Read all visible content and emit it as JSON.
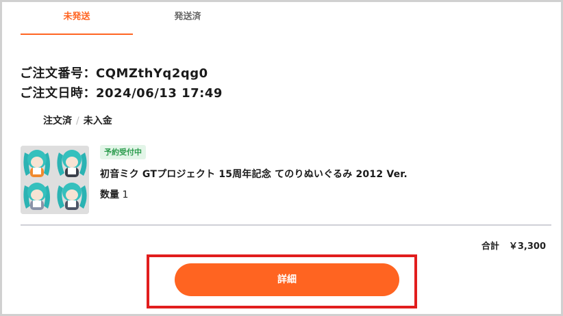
{
  "tabs": [
    {
      "label": "未発送",
      "active": true
    },
    {
      "label": "発送済",
      "active": false
    }
  ],
  "order": {
    "number_line": "ご注文番号：CQMZthYq2qg0",
    "date_line": "ご注文日時：2024/06/13 17:49",
    "status_primary": "注文済",
    "status_separator": "/",
    "status_secondary": "未入金"
  },
  "item": {
    "image": "product-thumbnail",
    "badge": "予約受付中",
    "name": "初音ミク GTプロジェクト 15周年記念 てのりぬいぐるみ 2012 Ver.",
    "quantity_label": "数量",
    "quantity_value": "1"
  },
  "summary": {
    "total_label": "合計",
    "total_value": "￥3,300"
  },
  "actions": {
    "detail_label": "詳細"
  },
  "colors": {
    "accent": "#ff6421",
    "highlight_box": "#e11d1d",
    "badge_bg": "#e3f5e8",
    "badge_text": "#2a9b4c"
  }
}
